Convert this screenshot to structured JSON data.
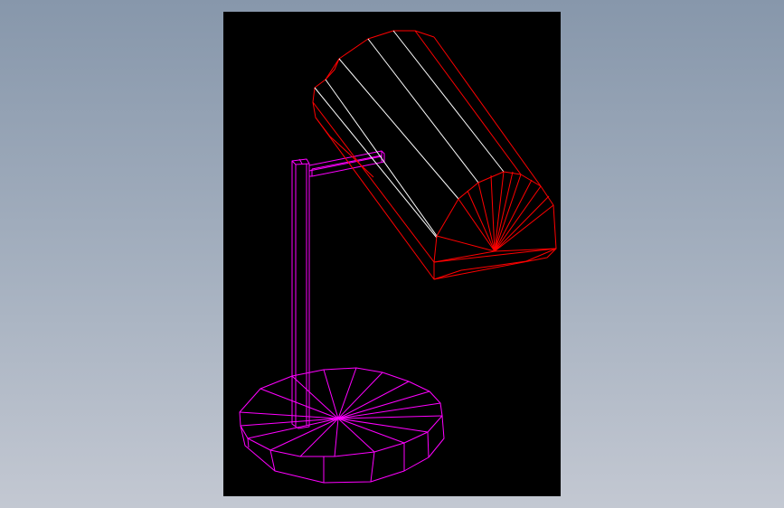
{
  "scene": {
    "background_color": "#000000",
    "page_gradient": [
      "#8797ab",
      "#c3c8d2"
    ],
    "object": "desk-lamp-wireframe",
    "colors": {
      "base": "#ff00ff",
      "pole": "#ff00ff",
      "arm": "#ff00ff",
      "shade": "#ff0000",
      "shade_highlight": "#ffffff"
    },
    "base_segments": 16,
    "shade_end_segments": 12
  }
}
